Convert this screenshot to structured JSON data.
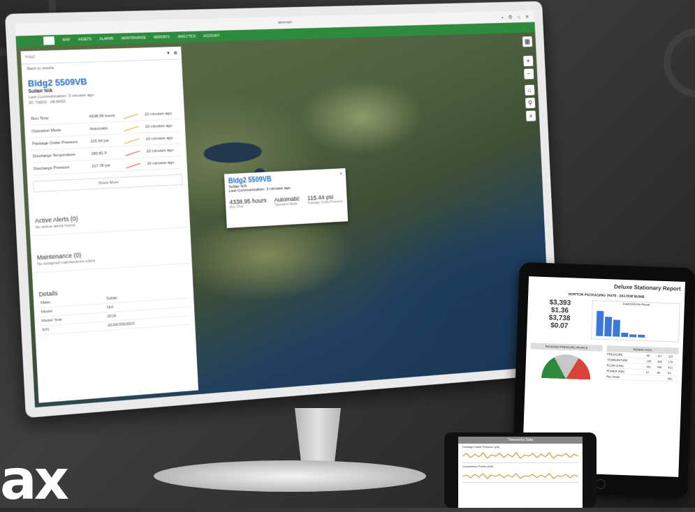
{
  "browser": {
    "url": "airsmart",
    "controls": "• ⚙ ○ ✕"
  },
  "nav": {
    "items": [
      "MAP",
      "ASSETS",
      "ALARMS",
      "MAINTENANCE",
      "REPORTS",
      "ANALYTICS",
      "ACCOUNT"
    ]
  },
  "panel": {
    "search_value": "bldg2",
    "back_link": "Back to results",
    "unit_title": "Bldg2 5509VB",
    "unit_subtitle": "Sullair N/A",
    "last_comm": "Last Communication: 3 minutes ago",
    "unit_id": "ID: 70003 · 06-8452",
    "metrics": [
      {
        "name": "Run Time",
        "value": "4338.95 hours",
        "ago": "10 minutes ago",
        "trend": "normal"
      },
      {
        "name": "Operation Mode",
        "value": "Automatic",
        "ago": "10 minutes ago",
        "trend": "normal"
      },
      {
        "name": "Package Outlet Pressure",
        "value": "115.44 psi",
        "ago": "10 minutes ago",
        "trend": "normal"
      },
      {
        "name": "Discharge Temperature",
        "value": "180.81 F",
        "ago": "10 minutes ago",
        "trend": "alert"
      },
      {
        "name": "Discharge Pressure",
        "value": "117.78 psi",
        "ago": "10 minutes ago",
        "trend": "alert"
      }
    ],
    "show_more": "Show More",
    "alerts_title": "Active Alerts (0)",
    "alerts_text": "No active alerts found.",
    "maint_title": "Maintenance (0)",
    "maint_text": "No assigned maintenance plans.",
    "details_title": "Details",
    "details": [
      {
        "k": "Make",
        "v": "Sullair"
      },
      {
        "k": "Model",
        "v": "N/A"
      },
      {
        "k": "Model Year",
        "v": "2016"
      },
      {
        "k": "S/N",
        "v": "201603000029"
      }
    ]
  },
  "popup": {
    "title": "Bldg2 5509VB",
    "sub": "Sullair N/A",
    "last": "Last Communication: 3 minutes ago",
    "close": "×",
    "stats": [
      {
        "value": "4338.95 hours",
        "label": "Run Time"
      },
      {
        "value": "Automatic",
        "label": "Operation Mode"
      },
      {
        "value": "115.44 psi",
        "label": "Package Outlet Pressure"
      }
    ]
  },
  "map_controls": [
    "+",
    "−",
    "⌂",
    "⚲",
    "⌕"
  ],
  "tablet": {
    "title": "Deluxe Stationary Report",
    "subtitle": "NORTON PACKAGING 76479 - 2017/DB'NUMB",
    "money": [
      "$3,393",
      "$1.36",
      "$3,738",
      "$0.07"
    ],
    "chart_title": "Cost/1000 Per Pound",
    "bars": [
      0.9,
      0.7,
      0.6,
      0.15,
      0.1,
      0.1
    ],
    "gauge_title": "PACKAGE PRESSURE PROFILE",
    "period_title": "PERIOD DATA",
    "rows": [
      [
        "PRESSURE",
        "98",
        "117",
        "115"
      ],
      [
        "TEMPERATURE",
        "165",
        "182",
        "176"
      ],
      [
        "FLOW (CFM)",
        "301",
        "445",
        "412"
      ],
      [
        "POWER (KW)",
        "67",
        "90",
        "84"
      ]
    ],
    "run_hours_label": "Run Hours",
    "run_hours": "862"
  },
  "phone": {
    "header": "Timeseries Data",
    "trend1": "Package Outlet Pressure (psi)",
    "trend2": "Compressor Power (KW)"
  }
}
